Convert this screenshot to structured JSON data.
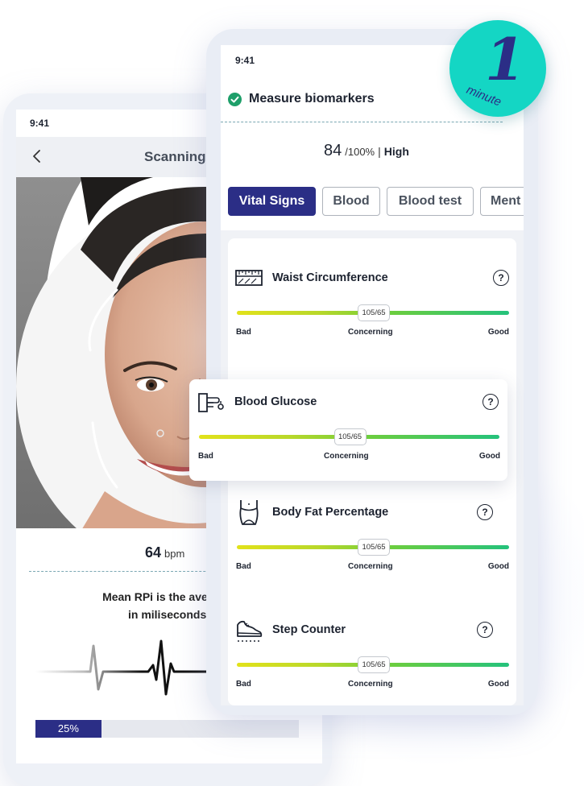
{
  "scan_screen": {
    "status_time": "9:41",
    "header_title": "Scanning",
    "bpm_value": "64",
    "bpm_unit": "bpm",
    "description_line1": "Mean RPi is the average time bet",
    "description_line2": "in miliseconds",
    "progress_percent": 25,
    "progress_label": "25%"
  },
  "results_screen": {
    "status_time": "9:41",
    "title": "Measure biomarkers",
    "score_value": "84",
    "score_scale": "/100%",
    "score_separator": "|",
    "score_level": "High",
    "tabs": [
      {
        "label": "Vital Signs",
        "active": true
      },
      {
        "label": "Blood",
        "active": false
      },
      {
        "label": "Blood test",
        "active": false
      },
      {
        "label": "Ment",
        "active": false
      }
    ],
    "metrics": [
      {
        "name": "Waist Circumference",
        "value_label": "105/65",
        "value_fraction": 0.5,
        "low_label": "Bad",
        "mid_label": "Concerning",
        "high_label": "Good",
        "help": "?"
      },
      {
        "name": "Blood Glucose",
        "value_label": "105/65",
        "value_fraction": 0.5,
        "low_label": "Bad",
        "mid_label": "Concerning",
        "high_label": "Good",
        "help": "?"
      },
      {
        "name": "Body Fat Percentage",
        "value_label": "105/65",
        "value_fraction": 0.5,
        "low_label": "Bad",
        "mid_label": "Concerning",
        "high_label": "Good",
        "help": "?"
      },
      {
        "name": "Step Counter",
        "value_label": "105/65",
        "value_fraction": 0.5,
        "low_label": "Bad",
        "mid_label": "Concerning",
        "high_label": "Good",
        "help": "?"
      }
    ]
  },
  "badge": {
    "number": "1",
    "unit": "minute"
  },
  "colors": {
    "brand_navy": "#2b2e86",
    "badge_teal": "#14d6c4",
    "success_green": "#1e9f6a",
    "gauge_start": "#e2e21a",
    "gauge_end": "#24c27c"
  },
  "icons": {
    "back": "chevron-left-icon",
    "check": "check-circle-icon",
    "waist": "measuring-tape-icon",
    "glucose": "glucose-meter-icon",
    "body_fat": "body-torso-icon",
    "steps": "sneaker-icon",
    "help": "question-circle-icon"
  }
}
